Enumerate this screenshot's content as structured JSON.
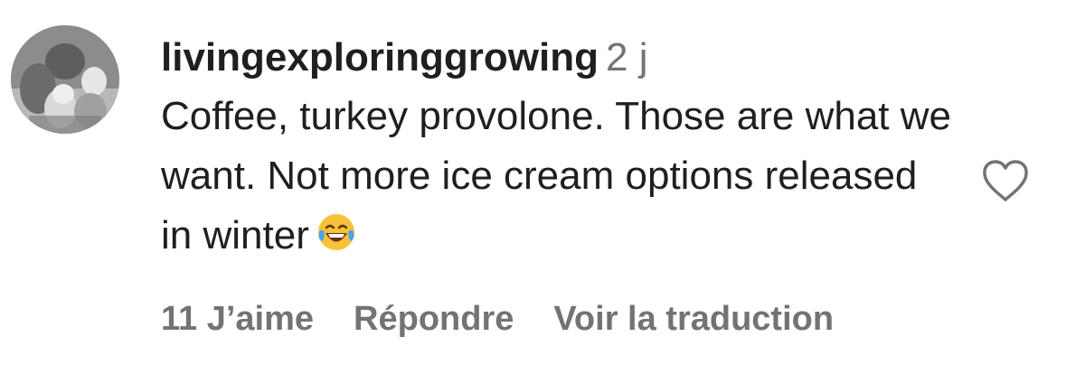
{
  "comment": {
    "username": "livingexploringgrowing",
    "time": "2 j",
    "text": "Coffee, turkey provolone. Those are what we want. Not more ice cream options released in winter",
    "emoji": "face-with-tears-of-joy"
  },
  "actions": {
    "likes": "11 J’aime",
    "reply": "Répondre",
    "translate": "Voir la traduction"
  },
  "icons": {
    "like": "heart-outline-icon"
  },
  "colors": {
    "text": "#1f1f1f",
    "secondary": "#737373"
  }
}
